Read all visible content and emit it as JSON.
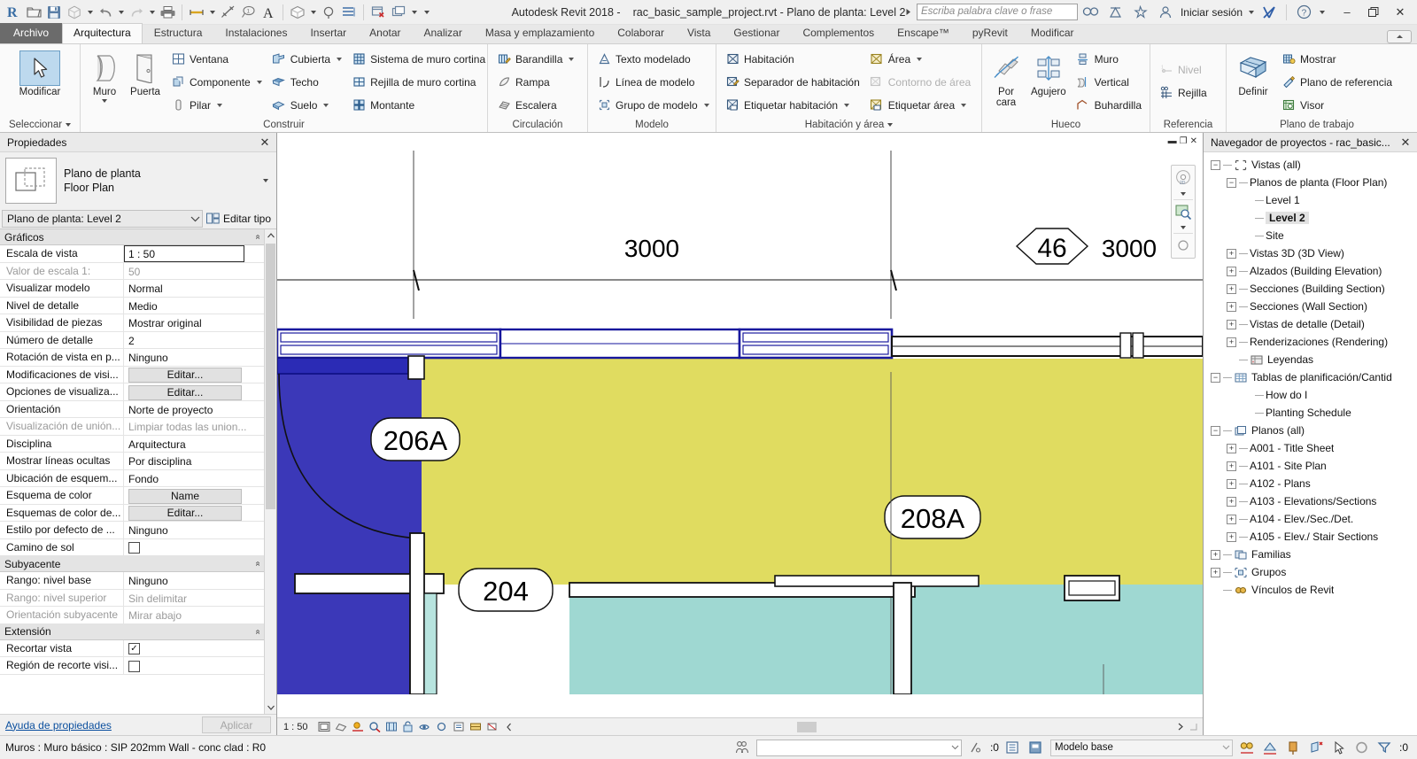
{
  "app": {
    "title_product": "Autodesk Revit 2018 -",
    "title_file": "rac_basic_sample_project.rvt - Plano de planta: Level 2"
  },
  "quick_access": {
    "items": [
      {
        "name": "revit-logo-icon",
        "label": "R"
      },
      {
        "name": "open-icon",
        "label": "Abrir"
      },
      {
        "name": "save-icon",
        "label": "Guardar"
      },
      {
        "name": "save-as-icon",
        "label": "Guardar como"
      },
      {
        "name": "undo-icon",
        "label": "Deshacer"
      },
      {
        "name": "redo-icon",
        "label": "Rehacer"
      },
      {
        "name": "print-icon",
        "label": "Imprimir"
      },
      {
        "name": "measure-icon",
        "label": "Medir"
      },
      {
        "name": "aligned-dimension-icon",
        "label": "Cota alineada"
      },
      {
        "name": "tag-icon",
        "label": "Etiqueta"
      },
      {
        "name": "text-icon",
        "label": "Texto"
      },
      {
        "name": "default-3d-view-icon",
        "label": "Vista 3D por defecto"
      },
      {
        "name": "section-icon",
        "label": "Sección"
      },
      {
        "name": "thin-lines-icon",
        "label": "Líneas finas"
      },
      {
        "name": "close-hidden-windows-icon",
        "label": "Cerrar ventanas ocultas"
      },
      {
        "name": "switch-windows-icon",
        "label": "Cambiar ventanas"
      },
      {
        "name": "customize-qat-icon",
        "label": "Personalizar"
      }
    ]
  },
  "infocenter": {
    "search_placeholder": "Escriba palabra clave o frase",
    "buttons": [
      {
        "name": "search-icon",
        "label": "Buscar"
      },
      {
        "name": "subscription-center-icon",
        "label": "Centro de suscripción"
      },
      {
        "name": "favorites-star-icon",
        "label": "Favoritos"
      }
    ],
    "sign_in_label": "Iniciar sesión",
    "autodesk-app-icon": "X",
    "help_label": "?"
  },
  "window_controls": {
    "minimize": "–",
    "restore": "❐",
    "close": "✕"
  },
  "ribbon": {
    "tabs": [
      {
        "label": "Archivo",
        "name": "tab-archivo",
        "style": "file"
      },
      {
        "label": "Arquitectura",
        "name": "tab-arquitectura",
        "style": "active"
      },
      {
        "label": "Estructura",
        "name": "tab-estructura",
        "style": ""
      },
      {
        "label": "Instalaciones",
        "name": "tab-instalaciones",
        "style": ""
      },
      {
        "label": "Insertar",
        "name": "tab-insertar",
        "style": ""
      },
      {
        "label": "Anotar",
        "name": "tab-anotar",
        "style": ""
      },
      {
        "label": "Analizar",
        "name": "tab-analizar",
        "style": ""
      },
      {
        "label": "Masa y emplazamiento",
        "name": "tab-masa-y-emplazamiento",
        "style": ""
      },
      {
        "label": "Colaborar",
        "name": "tab-colaborar",
        "style": ""
      },
      {
        "label": "Vista",
        "name": "tab-vista",
        "style": ""
      },
      {
        "label": "Gestionar",
        "name": "tab-gestionar",
        "style": ""
      },
      {
        "label": "Complementos",
        "name": "tab-complementos",
        "style": ""
      },
      {
        "label": "Enscape™",
        "name": "tab-enscape",
        "style": ""
      },
      {
        "label": "pyRevit",
        "name": "tab-pyrevit",
        "style": ""
      },
      {
        "label": "Modificar",
        "name": "tab-modificar",
        "style": ""
      }
    ],
    "panels": {
      "select": {
        "title": "Seleccionar",
        "modify_label": "Modificar"
      },
      "build": {
        "title": "Construir",
        "wall_label": "Muro",
        "door_label": "Puerta",
        "col1": [
          {
            "label": "Ventana",
            "icon": "window-icon",
            "drop": false
          },
          {
            "label": "Componente",
            "icon": "component-icon",
            "drop": true
          },
          {
            "label": "Pilar",
            "icon": "column-icon",
            "drop": true
          }
        ],
        "col2": [
          {
            "label": "Cubierta",
            "icon": "roof-icon",
            "drop": true
          },
          {
            "label": "Techo",
            "icon": "ceiling-icon",
            "drop": false
          },
          {
            "label": "Suelo",
            "icon": "floor-icon",
            "drop": true
          }
        ],
        "col3": [
          {
            "label": "Sistema de muro cortina",
            "icon": "curtain-system-icon",
            "drop": false
          },
          {
            "label": "Rejilla de muro cortina",
            "icon": "curtain-grid-icon",
            "drop": false
          },
          {
            "label": "Montante",
            "icon": "mullion-icon",
            "drop": false
          }
        ]
      },
      "circulation": {
        "title": "Circulación",
        "items": [
          {
            "label": "Barandilla",
            "icon": "railing-icon",
            "drop": true
          },
          {
            "label": "Rampa",
            "icon": "ramp-icon",
            "drop": false
          },
          {
            "label": "Escalera",
            "icon": "stair-icon",
            "drop": false
          }
        ]
      },
      "model": {
        "title": "Modelo",
        "items": [
          {
            "label": "Texto modelado",
            "icon": "model-text-icon",
            "drop": false
          },
          {
            "label": "Línea de modelo",
            "icon": "model-line-icon",
            "drop": false
          },
          {
            "label": "Grupo de modelo",
            "icon": "model-group-icon",
            "drop": true
          }
        ]
      },
      "room_area": {
        "title": "Habitación y área",
        "col1": [
          {
            "label": "Habitación",
            "icon": "room-icon",
            "drop": false,
            "dim": false
          },
          {
            "label": "Separador  de habitación",
            "icon": "room-separator-icon",
            "drop": false,
            "dim": false
          },
          {
            "label": "Etiquetar  habitación",
            "icon": "tag-room-icon",
            "drop": true,
            "dim": false
          }
        ],
        "col2": [
          {
            "label": "Área",
            "icon": "area-icon",
            "drop": true,
            "dim": false
          },
          {
            "label": "Contorno  de área",
            "icon": "area-boundary-icon",
            "drop": false,
            "dim": true
          },
          {
            "label": "Etiquetar  área",
            "icon": "tag-area-icon",
            "drop": true,
            "dim": false
          }
        ]
      },
      "opening": {
        "title": "Hueco",
        "by_face_label": "Por\ncara",
        "by_face_l1": "Por",
        "by_face_l2": "cara",
        "shaft_label": "Agujero",
        "items": [
          {
            "label": "Muro",
            "icon": "wall-opening-icon"
          },
          {
            "label": "Vertical",
            "icon": "vertical-opening-icon"
          },
          {
            "label": "Buhardilla",
            "icon": "dormer-opening-icon"
          }
        ]
      },
      "datum": {
        "title": "Referencia",
        "items": [
          {
            "label": "Nivel",
            "icon": "level-icon",
            "dim": true
          },
          {
            "label": "Rejilla",
            "icon": "grid-icon",
            "dim": false
          }
        ]
      },
      "workplane": {
        "title": "Plano de trabajo",
        "set_label": "Definir",
        "items": [
          {
            "label": "Mostrar",
            "icon": "show-workplane-icon"
          },
          {
            "label": "Plano de referencia",
            "icon": "reference-plane-icon"
          },
          {
            "label": "Visor",
            "icon": "viewer-icon"
          }
        ]
      }
    }
  },
  "properties": {
    "panel_title": "Propiedades",
    "close_label": "✕",
    "type_line1": "Plano de planta",
    "type_line2": "Floor Plan",
    "selector_value": "Plano de planta: Level 2",
    "edit_type_label": "Editar tipo",
    "help_link": "Ayuda de propiedades",
    "apply_label": "Aplicar",
    "groups": [
      {
        "name": "Gráficos",
        "rows": [
          {
            "name": "Escala de vista",
            "value": "1 : 50",
            "kind": "boxed",
            "dim": false
          },
          {
            "name": "Valor de escala    1:",
            "value": "50",
            "kind": "text",
            "dim": true
          },
          {
            "name": "Visualizar modelo",
            "value": "Normal",
            "kind": "text",
            "dim": false
          },
          {
            "name": "Nivel de detalle",
            "value": "Medio",
            "kind": "text",
            "dim": false
          },
          {
            "name": "Visibilidad de piezas",
            "value": "Mostrar original",
            "kind": "text",
            "dim": false
          },
          {
            "name": "Número de detalle",
            "value": "2",
            "kind": "text",
            "dim": false
          },
          {
            "name": "Rotación de vista en p...",
            "value": "Ninguno",
            "kind": "text",
            "dim": false
          },
          {
            "name": "Modificaciones de visi...",
            "value": "Editar...",
            "kind": "button",
            "dim": false
          },
          {
            "name": "Opciones de visualiza...",
            "value": "Editar...",
            "kind": "button",
            "dim": false
          },
          {
            "name": "Orientación",
            "value": "Norte de proyecto",
            "kind": "text",
            "dim": false
          },
          {
            "name": "Visualización de unión...",
            "value": "Limpiar todas las union...",
            "kind": "text",
            "dim": true
          },
          {
            "name": "Disciplina",
            "value": "Arquitectura",
            "kind": "text",
            "dim": false
          },
          {
            "name": "Mostrar líneas ocultas",
            "value": "Por disciplina",
            "kind": "text",
            "dim": false
          },
          {
            "name": "Ubicación de esquem...",
            "value": "Fondo",
            "kind": "text",
            "dim": false
          },
          {
            "name": "Esquema de color",
            "value": "Name",
            "kind": "button",
            "dim": false
          },
          {
            "name": "Esquemas de color de...",
            "value": "Editar...",
            "kind": "button",
            "dim": false
          },
          {
            "name": "Estilo por defecto de ...",
            "value": "Ninguno",
            "kind": "text",
            "dim": false
          },
          {
            "name": "Camino de sol",
            "value": "",
            "kind": "checkbox-empty",
            "dim": false
          }
        ]
      },
      {
        "name": "Subyacente",
        "rows": [
          {
            "name": "Rango: nivel base",
            "value": "Ninguno",
            "kind": "text",
            "dim": false
          },
          {
            "name": "Rango: nivel superior",
            "value": "Sin delimitar",
            "kind": "text",
            "dim": true
          },
          {
            "name": "Orientación subyacente",
            "value": "Mirar abajo",
            "kind": "text",
            "dim": true
          }
        ]
      },
      {
        "name": "Extensión",
        "rows": [
          {
            "name": "Recortar vista",
            "value": "",
            "kind": "checkbox-checked",
            "dim": false
          },
          {
            "name": "Región de recorte visi...",
            "value": "",
            "kind": "checkbox-empty",
            "dim": false
          }
        ]
      }
    ]
  },
  "browser": {
    "panel_title": "Navegador de proyectos - rac_basic...",
    "close_label": "✕",
    "nodes": [
      {
        "label": "Vistas (all)",
        "indent": 0,
        "toggle": "minus",
        "icon": "views-icon",
        "selected": false
      },
      {
        "label": "Planos de planta (Floor Plan)",
        "indent": 1,
        "toggle": "minus",
        "icon": "",
        "selected": false
      },
      {
        "label": "Level 1",
        "indent": 2,
        "toggle": "leaf",
        "icon": "",
        "selected": false
      },
      {
        "label": "Level 2",
        "indent": 2,
        "toggle": "leaf",
        "icon": "",
        "selected": true
      },
      {
        "label": "Site",
        "indent": 2,
        "toggle": "leaf",
        "icon": "",
        "selected": false
      },
      {
        "label": "Vistas 3D (3D View)",
        "indent": 1,
        "toggle": "plus",
        "icon": "",
        "selected": false
      },
      {
        "label": "Alzados (Building Elevation)",
        "indent": 1,
        "toggle": "plus",
        "icon": "",
        "selected": false
      },
      {
        "label": "Secciones (Building Section)",
        "indent": 1,
        "toggle": "plus",
        "icon": "",
        "selected": false
      },
      {
        "label": "Secciones (Wall Section)",
        "indent": 1,
        "toggle": "plus",
        "icon": "",
        "selected": false
      },
      {
        "label": "Vistas de detalle (Detail)",
        "indent": 1,
        "toggle": "plus",
        "icon": "",
        "selected": false
      },
      {
        "label": "Renderizaciones (Rendering)",
        "indent": 1,
        "toggle": "plus",
        "icon": "",
        "selected": false
      },
      {
        "label": "Leyendas",
        "indent": 1,
        "toggle": "none",
        "icon": "legend-icon",
        "selected": false
      },
      {
        "label": "Tablas de planificación/Cantid",
        "indent": 0,
        "toggle": "minus",
        "icon": "schedule-icon",
        "selected": false
      },
      {
        "label": "How do I",
        "indent": 2,
        "toggle": "leaf",
        "icon": "",
        "selected": false
      },
      {
        "label": "Planting Schedule",
        "indent": 2,
        "toggle": "leaf",
        "icon": "",
        "selected": false
      },
      {
        "label": "Planos (all)",
        "indent": 0,
        "toggle": "minus",
        "icon": "sheets-icon",
        "selected": false
      },
      {
        "label": "A001 - Title Sheet",
        "indent": 1,
        "toggle": "plus",
        "icon": "",
        "selected": false
      },
      {
        "label": "A101 - Site Plan",
        "indent": 1,
        "toggle": "plus",
        "icon": "",
        "selected": false
      },
      {
        "label": "A102 - Plans",
        "indent": 1,
        "toggle": "plus",
        "icon": "",
        "selected": false
      },
      {
        "label": "A103 - Elevations/Sections",
        "indent": 1,
        "toggle": "plus",
        "icon": "",
        "selected": false
      },
      {
        "label": "A104 - Elev./Sec./Det.",
        "indent": 1,
        "toggle": "plus",
        "icon": "",
        "selected": false
      },
      {
        "label": "A105 - Elev./ Stair Sections",
        "indent": 1,
        "toggle": "plus",
        "icon": "",
        "selected": false
      },
      {
        "label": "Familias",
        "indent": 0,
        "toggle": "plus",
        "icon": "families-icon",
        "selected": false
      },
      {
        "label": "Grupos",
        "indent": 0,
        "toggle": "plus",
        "icon": "groups-icon",
        "selected": false
      },
      {
        "label": "Vínculos de Revit",
        "indent": 0,
        "toggle": "none",
        "icon": "revit-links-icon",
        "selected": false
      }
    ]
  },
  "canvas": {
    "view_scale": "1 : 50",
    "dimension_left": "3000",
    "dimension_right": "3000",
    "grid_bubble": "46",
    "room_tags": [
      "206A",
      "208A",
      "204"
    ],
    "colors": {
      "room_yellow": "#e0dc60",
      "room_blue": "#3b38b8",
      "room_teal": "#64c8c2",
      "wall_blue": "#1a1a9e"
    },
    "view_controls": [
      {
        "name": "visual-style-icon",
        "label": "Estilo visual"
      },
      {
        "name": "shadows-icon",
        "label": "Sombras"
      },
      {
        "name": "sun-path-icon",
        "label": "Camino de sol"
      },
      {
        "name": "crop-view-icon",
        "label": "Recortar vista"
      },
      {
        "name": "show-crop-region-icon",
        "label": "Mostrar región de recorte"
      },
      {
        "name": "unlock-3d-view-icon",
        "label": "Bloquear vista 3D"
      },
      {
        "name": "temp-hide-isolate-icon",
        "label": "Ocultar/aislar temporal"
      },
      {
        "name": "reveal-hidden-icon",
        "label": "Mostrar elementos ocultos"
      },
      {
        "name": "temp-view-properties-icon",
        "label": "Propiedades de vista temporales"
      },
      {
        "name": "hide-analytical-icon",
        "label": "Ocultar modelo analítico"
      },
      {
        "name": "reveal-constraints-icon",
        "label": "Mostrar restricciones"
      }
    ]
  },
  "statusbar": {
    "selection_text": "Muros : Muro básico : SIP 202mm Wall - conc clad : R0",
    "filter_value": "",
    "exclude_count": ":0",
    "worksets_value": "Modelo base",
    "filter_count": ":0",
    "right_icons": [
      {
        "name": "select-links-icon",
        "label": "Seleccionar vínculos"
      },
      {
        "name": "select-underlay-icon",
        "label": "Seleccionar subyacentes"
      },
      {
        "name": "select-pinned-icon",
        "label": "Seleccionar elementos fijados"
      },
      {
        "name": "select-by-face-icon",
        "label": "Seleccionar por cara"
      },
      {
        "name": "drag-elements-icon",
        "label": "Arrastrar elementos"
      },
      {
        "name": "unsaved-changes-icon",
        "label": "Cambios no guardados"
      },
      {
        "name": "filter-icon",
        "label": "Filtrar"
      }
    ]
  }
}
